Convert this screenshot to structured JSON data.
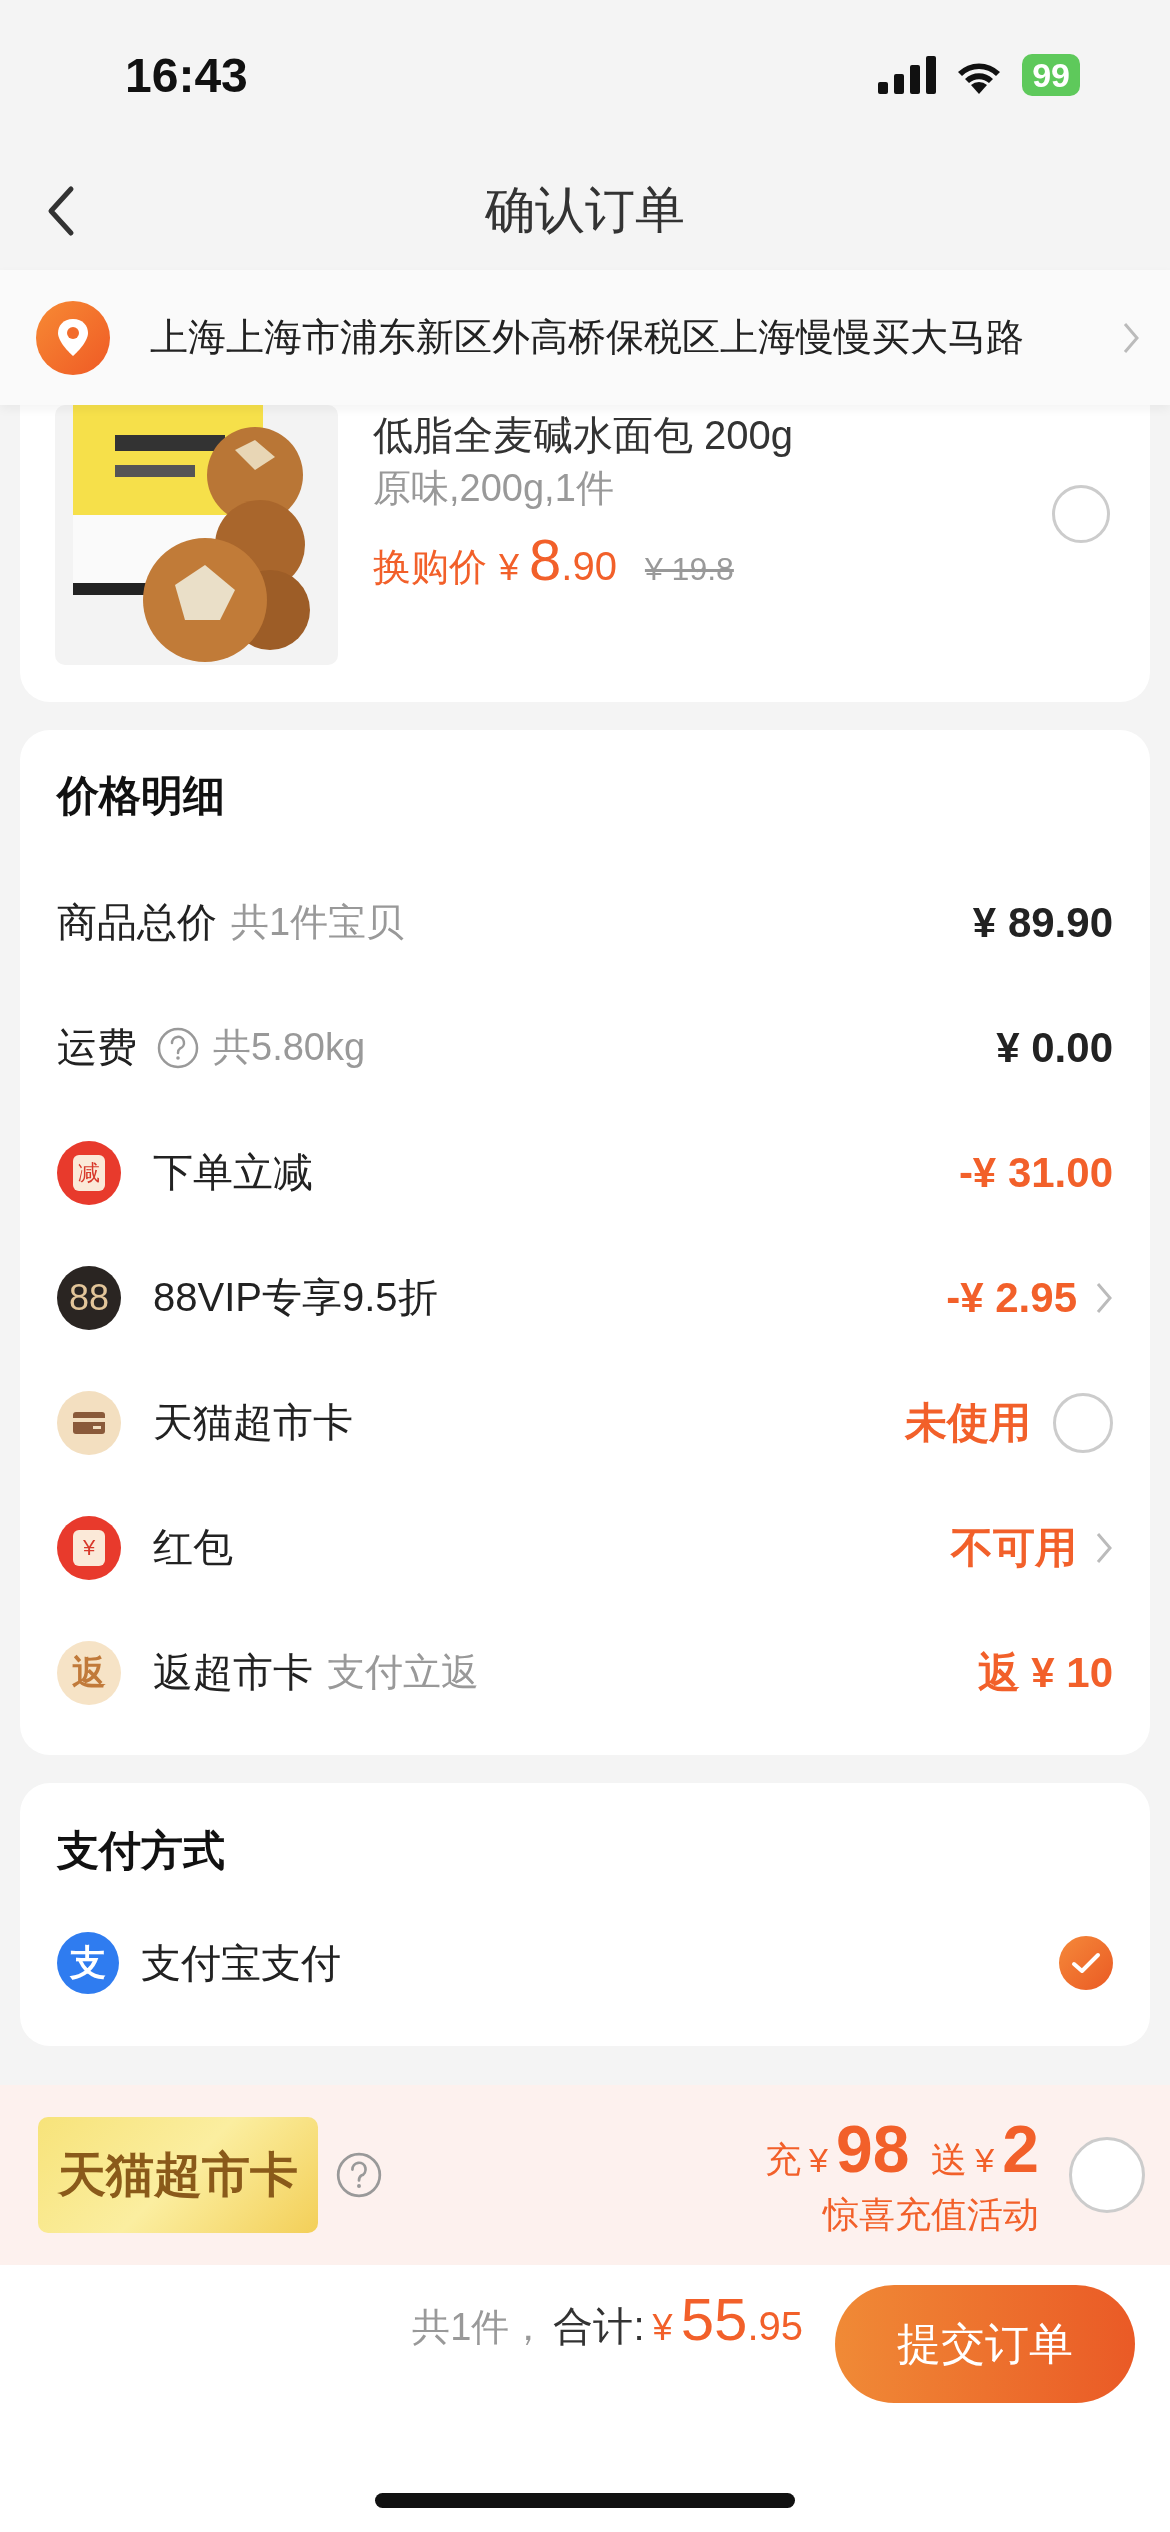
{
  "status_bar": {
    "time": "16:43",
    "battery": "99"
  },
  "nav": {
    "title": "确认订单"
  },
  "address": {
    "text": "上海上海市浦东新区外高桥保税区上海慢慢买大马路"
  },
  "product": {
    "title": "低脂全麦碱水面包 200g",
    "variant": "原味,200g,1件",
    "price_label": "换购价",
    "currency": "¥",
    "price_int": "8",
    "price_dec": ".90",
    "original_price": "¥ 19.8",
    "selected": false
  },
  "price_details": {
    "title": "价格明细",
    "rows": [
      {
        "kind": "plain",
        "label": "商品总价",
        "note": "共1件宝贝",
        "value": "¥ 89.90",
        "emphasis": false
      },
      {
        "kind": "info",
        "label": "运费",
        "note": "共5.80kg",
        "value": "¥ 0.00",
        "emphasis": false
      },
      {
        "kind": "discount",
        "badge": "减",
        "label": "下单立减",
        "value": "-¥ 31.00",
        "emphasis": true
      },
      {
        "kind": "vip",
        "badge": "88",
        "label": "88VIP专享9.5折",
        "value": "-¥ 2.95",
        "emphasis": true,
        "chevron": true
      },
      {
        "kind": "card",
        "label": "天猫超市卡",
        "value": "未使用",
        "emphasis": true,
        "checked": false
      },
      {
        "kind": "redpacket",
        "badge": "¥",
        "label": "红包",
        "value": "不可用",
        "emphasis": true,
        "chevron": true
      },
      {
        "kind": "rebate",
        "badge": "返",
        "label": "返超市卡",
        "note": "支付立返",
        "value": "返 ¥ 10",
        "emphasis": true
      }
    ]
  },
  "payment": {
    "title": "支付方式",
    "methods": [
      {
        "name": "支付宝支付",
        "badge": "支",
        "selected": true
      }
    ]
  },
  "promo": {
    "badge": "天猫超市卡",
    "prefix": "充",
    "currency": "¥",
    "amount": "98",
    "bonus_prefix": "送",
    "bonus": "2",
    "subtitle": "惊喜充值活动",
    "checked": false
  },
  "footer": {
    "count": "共1件，",
    "total_label": "合计:",
    "currency": "¥",
    "total_int": "55",
    "total_dec": ".95",
    "submit": "提交订单"
  }
}
